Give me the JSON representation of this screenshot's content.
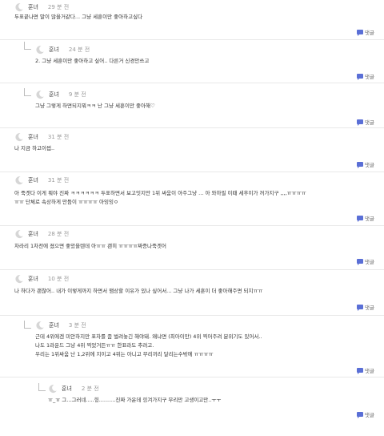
{
  "comments": [
    {
      "nick": "훈녀",
      "time": "29 분 전",
      "body": "두표끝나면 말이 많을거같다... 그냥 세훈이만 좋아하고싶다",
      "reply_label": "댓글"
    },
    {
      "nick": "훈녀",
      "time": "24 분 전",
      "body": "2. 그냥 세훈이만 좋아하고 싶어.. 다른거 신경안쓰고",
      "reply_label": "댓글"
    },
    {
      "nick": "훈녀",
      "time": "9 분 전",
      "body": "그냥 그렇게 하면되지뭐ㅋㅋ 난 그냥 세훈이만 좋아해♡",
      "reply_label": "댓글"
    },
    {
      "nick": "훈녀",
      "time": "31 분 전",
      "body": "나 지금 하고이썹..",
      "reply_label": "댓글"
    },
    {
      "nick": "훈녀",
      "time": "31 분 전",
      "body": "아 죽겟다 이게 뭐야 진짜 ㅋㅋㅋㅋㅋㅋ 두표하면서 보고잇지만 1위 싸움이 아주그냥 ... 아 와하필 이때 세후이가 꺼가지구 ,,,,ㅠㅠㅠㅠ\nㅠㅠ 단체로 속상하게 만듬이 ㅠㅠㅠㅠ 아잉잉ㅇ",
      "reply_label": "댓글"
    },
    {
      "nick": "훈녀",
      "time": "28 분 전",
      "body": "차라리 1차전에 졌으면 좋았을텐데 아ㅠㅠ 괜히 ㅠㅠㅠㅠ짜증나죽겟어",
      "reply_label": "댓글"
    },
    {
      "nick": "훈녀",
      "time": "10 분 전",
      "body": "나 하다가 괜찮어.. 내가 이렇게까지 하면서 맴상할 이유가 있나 싶어서... 그냥 나가 세훈이 더 좋아해주면 되지ㅠㅠ",
      "reply_label": "댓글"
    },
    {
      "nick": "훈녀",
      "time": "3 분 전",
      "body": "근데 4위에겐 미안하지만 표차를 좀 벌려놓긴 해야돼. 왜냐면 (최아이만) 4위 찍어주려 분위기도 있어서..\n나도 1라운드 그냥 4위 찍었거든ㅠㅠ 한표라도 추려고.\n우리는 1위싸움 난 1,2위에 지이고 4위는 아니고 무리끼리 달리는수밖에 ㅠㅠㅠㅠ",
      "reply_label": "댓글"
    },
    {
      "nick": "훈녀",
      "time": "2 분 전",
      "body": "ㅠ_ㅠ 그...그러네.....힝..........진짜 가운데 낑겨가지구 무리만 고생이고만..ㅜㅜ",
      "reply_label": "댓글"
    }
  ]
}
